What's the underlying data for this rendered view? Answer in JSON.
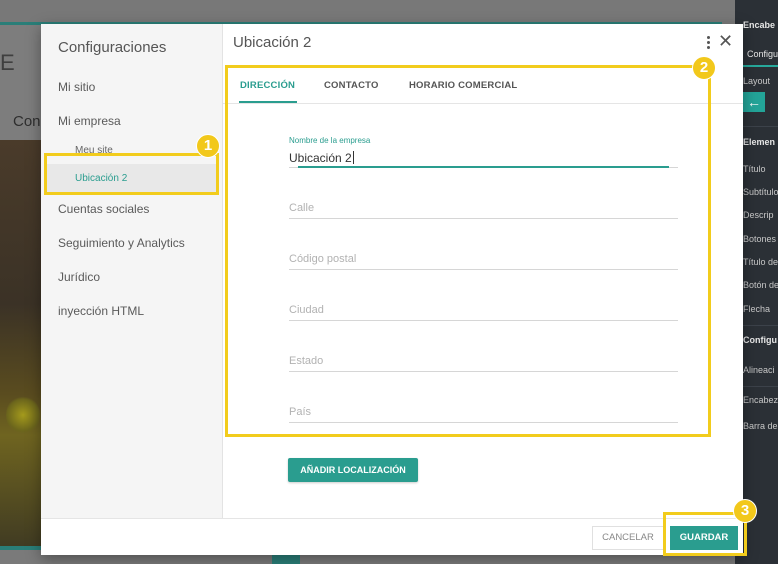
{
  "background": {
    "fragment_e": "E",
    "fragment_con": "Con"
  },
  "right_panel": {
    "items": [
      "Encabe",
      "Layout",
      "Elemen",
      "Título",
      "Subtítulo",
      "Descrip",
      "Botones",
      "Título de",
      "Botón de",
      "Flecha",
      "Configu",
      "Alineaci",
      "Encabez",
      "Barra de"
    ],
    "tab": "Configu",
    "arrow_icon": "arrow-left-icon"
  },
  "sidebar": {
    "title": "Configuraciones",
    "items": [
      "Mi sitio",
      "Mi empresa",
      "Cuentas sociales",
      "Seguimiento y Analytics",
      "Jurídico",
      "inyección HTML"
    ],
    "subitems": [
      "Meu site",
      "Ubicación 2"
    ]
  },
  "main": {
    "title": "Ubicación 2",
    "tabs": [
      "DIRECCIÓN",
      "CONTACTO",
      "HORARIO COMERCIAL"
    ],
    "company_label": "Nombre de la empresa",
    "company_value": "Ubicación 2",
    "placeholders": [
      "Calle",
      "Código postal",
      "Ciudad",
      "Estado",
      "País"
    ],
    "add_button": "AÑADIR LOCALIZACIÓN"
  },
  "footer": {
    "cancel": "CANCELAR",
    "save": "GUARDAR"
  },
  "callouts": [
    "1",
    "2",
    "3"
  ],
  "colors": {
    "accent": "#2a9d8f",
    "highlight": "#f2cc1c",
    "panel": "#2b3036"
  }
}
